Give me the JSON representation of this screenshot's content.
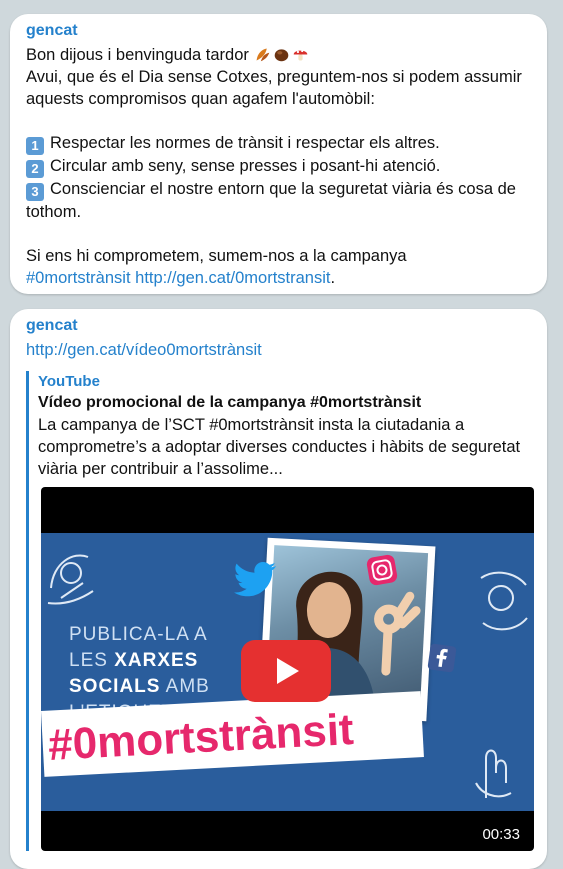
{
  "messages": [
    {
      "sender": "gencat",
      "greeting": "Bon dijous i benvinguda tardor",
      "intro": "Avui, que és el Dia sense Cotxes, preguntem-nos si podem assumir aquests compromisos quan agafem l'automòbil:",
      "items": [
        {
          "num": "1",
          "text": "Respectar les normes de trànsit i respectar els altres."
        },
        {
          "num": "2",
          "text": "Circular amb seny, sense presses i posant-hi atenció."
        },
        {
          "num": "3",
          "text": "Conscienciar el nostre entorn que la seguretat viària és cosa de tothom."
        }
      ],
      "closing": "Si ens hi comprometem, sumem-nos a la campanya",
      "hashtag": "#0mortstrànsit",
      "link": "http://gen.cat/0mortstransit",
      "end": "."
    },
    {
      "sender": "gencat",
      "url": "http://gen.cat/vídeo0mortstrànsit",
      "preview": {
        "site": "YouTube",
        "title": "Vídeo promocional de la campanya #0mortstrànsit",
        "description": "La campanya de l’SCT #0mortstrànsit insta la ciutadania a comprometre’s a adoptar diverses conductes i hàbits de seguretat viària per contribuir a l’assolime...",
        "video": {
          "line1": "PUBLICA-LA A",
          "line2a": "LES ",
          "line2b": "XARXES",
          "line3a": "SOCIALS",
          "line3b": " AMB",
          "line4": "L'ETIQUETA",
          "hashtag": "#0mortstrànsit",
          "duration": "00:33"
        }
      }
    }
  ],
  "icons": {
    "emoji": [
      "autumn-leaves-icon",
      "chestnut-icon",
      "mushroom-icon"
    ],
    "video": [
      "twitter-icon",
      "facebook-icon",
      "instagram-icon",
      "play-icon"
    ]
  },
  "colors": {
    "link": "#2481cc",
    "hashtag_pink": "#e6286c",
    "video_bg": "#2a5d9c",
    "play_red": "#e53030"
  }
}
